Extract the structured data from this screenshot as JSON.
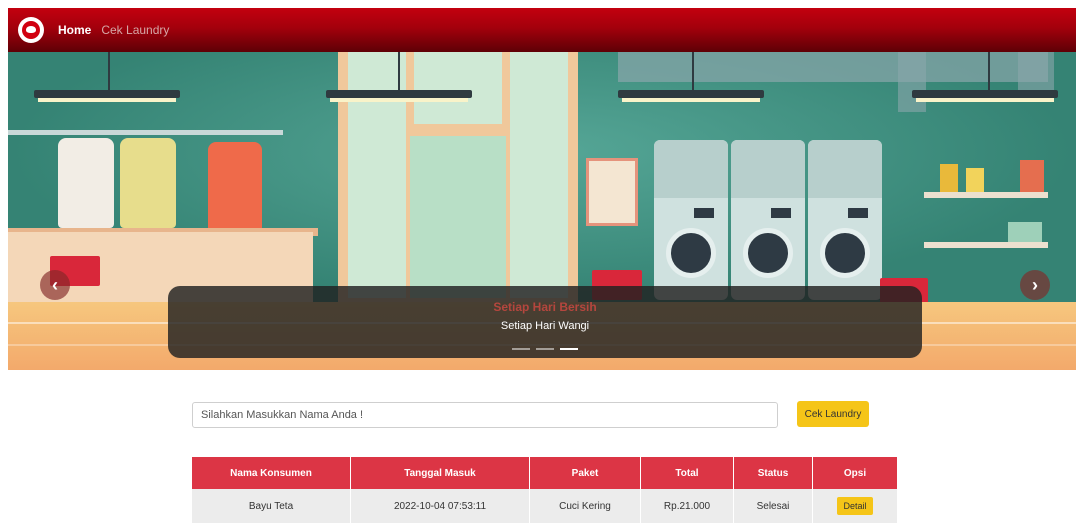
{
  "navbar": {
    "links": [
      {
        "label": "Home",
        "active": true
      },
      {
        "label": "Cek Laundry",
        "active": false
      }
    ]
  },
  "carousel": {
    "slide_title": "Setiap Hari Bersih",
    "slide_subtitle": "Setiap Hari Wangi",
    "prev_icon": "chevron-left-icon",
    "next_icon": "chevron-right-icon",
    "prev_glyph": "‹",
    "next_glyph": "›",
    "indicator_count": 3,
    "active_indicator": 3
  },
  "search": {
    "placeholder": "Silahkan Masukkan Nama Anda !",
    "value": "",
    "button_label": "Cek Laundry"
  },
  "table": {
    "headers": [
      "Nama Konsumen",
      "Tanggal Masuk",
      "Paket",
      "Total",
      "Status",
      "Opsi"
    ],
    "rows": [
      {
        "nama": "Bayu Teta",
        "tanggal": "2022-10-04 07:53:11",
        "paket": "Cuci Kering",
        "total": "Rp.21.000",
        "status": "Selesai",
        "opsi": "Detail"
      }
    ]
  },
  "colors": {
    "navbar": "#b0000c",
    "table_header": "#dc3545",
    "button_accent": "#f5c518"
  }
}
